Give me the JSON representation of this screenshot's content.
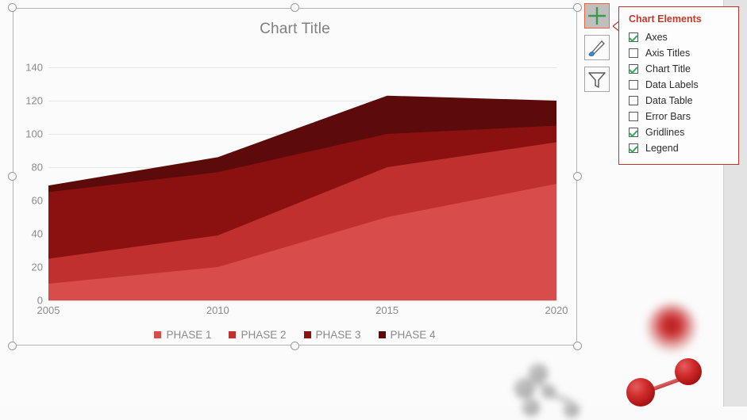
{
  "chart_data": {
    "type": "area",
    "stacked": true,
    "title": "Chart Title",
    "xlabel": "",
    "ylabel": "",
    "x": [
      2005,
      2010,
      2015,
      2020
    ],
    "xticks": [
      "2005",
      "2010",
      "2015",
      "2020"
    ],
    "yticks": [
      "0",
      "20",
      "40",
      "60",
      "80",
      "100",
      "120",
      "140"
    ],
    "ylim": [
      0,
      150
    ],
    "grid": true,
    "legend_position": "bottom",
    "series": [
      {
        "name": "PHASE 1",
        "color": "#d94c4c",
        "values": [
          10,
          20,
          50,
          70
        ]
      },
      {
        "name": "PHASE 2",
        "color": "#c0302f",
        "values": [
          15,
          19,
          30,
          25
        ]
      },
      {
        "name": "PHASE 3",
        "color": "#8b1111",
        "values": [
          40,
          38,
          20,
          10
        ]
      },
      {
        "name": "PHASE 4",
        "color": "#5c0a0a",
        "values": [
          4,
          9,
          23,
          15
        ]
      }
    ],
    "cumulative": [
      {
        "year": 2005,
        "tops": [
          10,
          25,
          65,
          69
        ]
      },
      {
        "year": 2010,
        "tops": [
          20,
          39,
          77,
          86
        ]
      },
      {
        "year": 2015,
        "tops": [
          50,
          80,
          100,
          123
        ]
      },
      {
        "year": 2020,
        "tops": [
          70,
          95,
          105,
          120
        ]
      }
    ]
  },
  "chart_buttons": [
    {
      "name": "chart-elements",
      "icon": "plus-icon",
      "active": true
    },
    {
      "name": "chart-styles",
      "icon": "paintbrush-icon",
      "active": false
    },
    {
      "name": "chart-filters",
      "icon": "funnel-icon",
      "active": false
    }
  ],
  "chart_elements_panel": {
    "title": "Chart Elements",
    "items": [
      {
        "label": "Axes",
        "checked": true
      },
      {
        "label": "Axis Titles",
        "checked": false
      },
      {
        "label": "Chart Title",
        "checked": true
      },
      {
        "label": "Data Labels",
        "checked": false
      },
      {
        "label": "Data Table",
        "checked": false
      },
      {
        "label": "Error Bars",
        "checked": false
      },
      {
        "label": "Gridlines",
        "checked": true
      },
      {
        "label": "Legend",
        "checked": true
      }
    ]
  },
  "colors": {
    "accent": "#c0392b",
    "check": "#2faa4e",
    "active_button_border": "#e8663c",
    "axis_text": "#8a8a8a",
    "title_text": "#7f7f7f"
  }
}
